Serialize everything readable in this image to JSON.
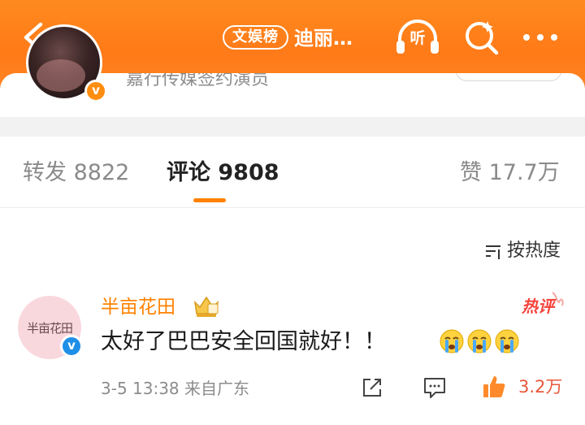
{
  "header": {
    "tag": "文娱榜",
    "title": "迪丽…",
    "listen_label": "听",
    "colors": {
      "bar": "#ff7a18"
    }
  },
  "profile": {
    "description": "嘉行传媒签约演员"
  },
  "tabs": {
    "repost": "转发 8822",
    "comments": "评论 9808",
    "likes": "赞 17.7万",
    "active": "comments"
  },
  "sort": {
    "label": "按热度"
  },
  "comment": {
    "avatar_text": "半亩花田",
    "username": "半亩花田",
    "hot_label": "热评",
    "text": "太好了巴巴安全回国就好！！",
    "emoji": [
      "crying-face",
      "crying-face",
      "crying-face"
    ],
    "meta": "3-5 13:38 来自广东",
    "likes": "3.2万",
    "colors": {
      "username": "#ff8200",
      "likes": "#e8573a"
    }
  }
}
